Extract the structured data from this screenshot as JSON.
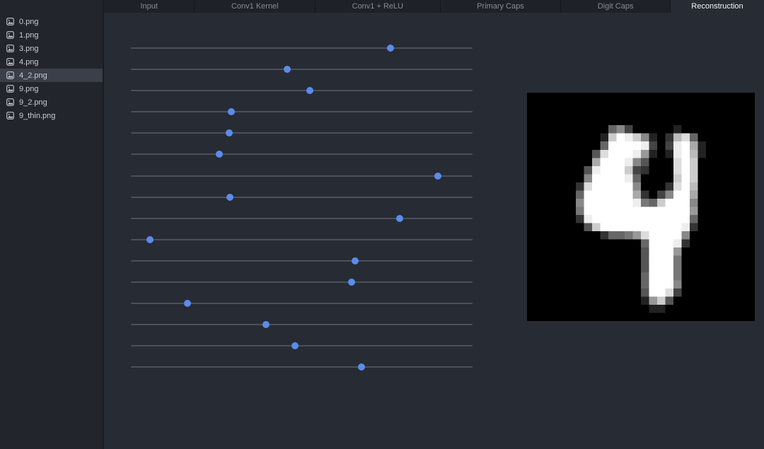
{
  "tabs": {
    "items": [
      {
        "label": "Input",
        "active": false
      },
      {
        "label": "Conv1 Kernel",
        "active": false
      },
      {
        "label": "Conv1 + ReLU",
        "active": false
      },
      {
        "label": "Primary Caps",
        "active": false
      },
      {
        "label": "Digit Caps",
        "active": false
      },
      {
        "label": "Reconstruction",
        "active": true
      }
    ]
  },
  "sidebar": {
    "files": [
      {
        "name": "0.png",
        "selected": false
      },
      {
        "name": "1.png",
        "selected": false
      },
      {
        "name": "3.png",
        "selected": false
      },
      {
        "name": "4.png",
        "selected": false
      },
      {
        "name": "4_2.png",
        "selected": true
      },
      {
        "name": "9.png",
        "selected": false
      },
      {
        "name": "9_2.png",
        "selected": false
      },
      {
        "name": "9_thin.png",
        "selected": false
      }
    ],
    "file_icon": "image-icon"
  },
  "sliders": {
    "description": "digit capsule dimension sliders, normalized handle positions 0-1",
    "values": [
      0.759,
      0.458,
      0.523,
      0.294,
      0.287,
      0.258,
      0.899,
      0.29,
      0.787,
      0.055,
      0.657,
      0.645,
      0.166,
      0.395,
      0.481,
      0.675
    ]
  },
  "reconstruction": {
    "digit": "4",
    "grid_size": 28,
    "pixels_hex_rows": [
      "0000000000000000000000000000",
      "0000000000000000000000000000",
      "0000000000000000000000000000",
      "0000000000000000000000000000",
      "0000000000684000002000000000",
      "0000000002cfec8203bd60000000",
      "0000000006ffffe404efa2000000",
      "000000005dfffe9202efb2000000",
      "00000000afffe85000dfc0000000",
      "00000005efffc43000dfc0000000",
      "00000008ffffe60000cfc0000000",
      "0000003dfffff80003dfb0000000",
      "0000006ffffffa3048ffa0000000",
      "0000008ffffffe76cfff80000000",
      "0000007fffffffffffff90000000",
      "0000003effffffffffff60000000",
      "00000005cffffffffffe30000000",
      "00000000036679dffff800000000",
      "000000000000006fffe300000000",
      "000000000000005fff9000000000",
      "000000000000005fff7000000000",
      "000000000000005fff7000000000",
      "000000000000006fff7000000000",
      "000000000000006fff8000000000",
      "000000000000005ffd4000000000",
      "0000000000000029c50000000000",
      "0000000000000002200000000000",
      "0000000000000000000000000000"
    ]
  },
  "colors": {
    "accent_blue": "#5b8bec",
    "slider_track": "#4b505a",
    "sidebar_bg": "#22252c",
    "selected_row_bg": "#3a3f49",
    "tabbar_bg": "#1e2128",
    "content_bg": "#272b33",
    "image_bg": "#000000"
  }
}
